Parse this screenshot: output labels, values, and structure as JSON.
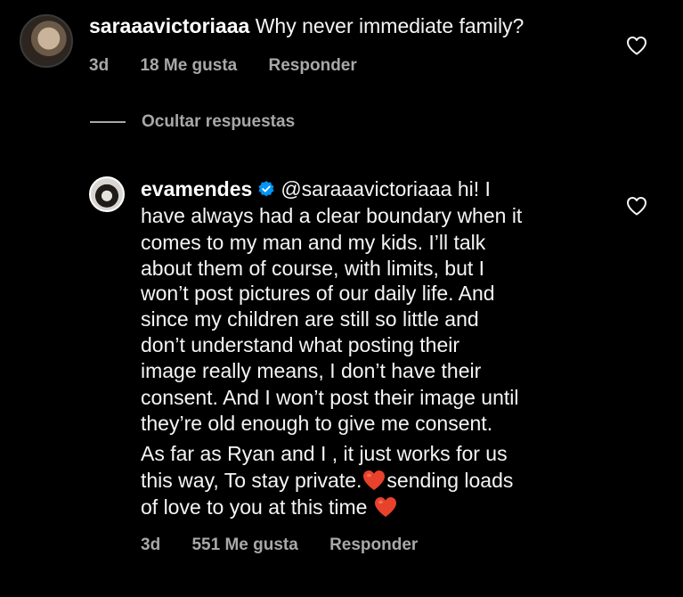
{
  "comment": {
    "username": "saraaavictoriaaa",
    "text": "Why never immediate family?",
    "time": "3d",
    "likes": "18 Me gusta",
    "reply_label": "Responder"
  },
  "hide_replies_label": "Ocultar respuestas",
  "reply": {
    "username": "evamendes",
    "mention": "@saraaavictoriaaa",
    "lines": [
      "hi! I",
      "have always had a clear boundary when it",
      "comes to my man and my kids. I’ll talk",
      "about them of course, with limits, but I",
      "won’t post pictures of our daily life. And",
      "since my children are still so little and",
      "don’t understand what posting their",
      "image really means, I don’t have their",
      "consent. And I won’t post their image until",
      "they’re old enough to give me consent.",
      "As far as Ryan and I , it just works for us",
      "this way, To stay private.",
      "sending loads",
      "of love to you at this time"
    ],
    "time": "3d",
    "likes": "551 Me gusta",
    "reply_label": "Responder"
  },
  "icons": {
    "like_icon": "heart-outline-icon",
    "verified_icon": "verified-badge-icon",
    "emoji": "red-heart-emoji"
  },
  "colors": {
    "background": "#000000",
    "text": "#f5f5f5",
    "secondary": "#a8a8a8",
    "verified": "#0095f6",
    "emoji_heart": "#e8412c"
  }
}
